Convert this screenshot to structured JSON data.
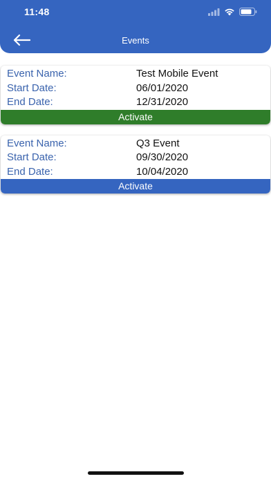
{
  "status_bar": {
    "time": "11:48",
    "icons": [
      "signal-icon",
      "wifi-icon",
      "battery-icon"
    ]
  },
  "header": {
    "title": "Events",
    "back_icon": "arrow-left-icon"
  },
  "events": [
    {
      "name_label": "Event Name:",
      "name": "Test Mobile Event",
      "start_label": "Start Date:",
      "start": "06/01/2020",
      "end_label": "End Date:",
      "end": "12/31/2020",
      "action_label": "Activate",
      "action_color": "#2f7d2a"
    },
    {
      "name_label": "Event Name:",
      "name": "Q3 Event",
      "start_label": "Start Date:",
      "start": "09/30/2020",
      "end_label": "End Date:",
      "end": "10/04/2020",
      "action_label": "Activate",
      "action_color": "#3565c0"
    }
  ],
  "colors": {
    "header_bg": "#3565c0",
    "label_text": "#3a63ad",
    "value_text": "#111111"
  }
}
